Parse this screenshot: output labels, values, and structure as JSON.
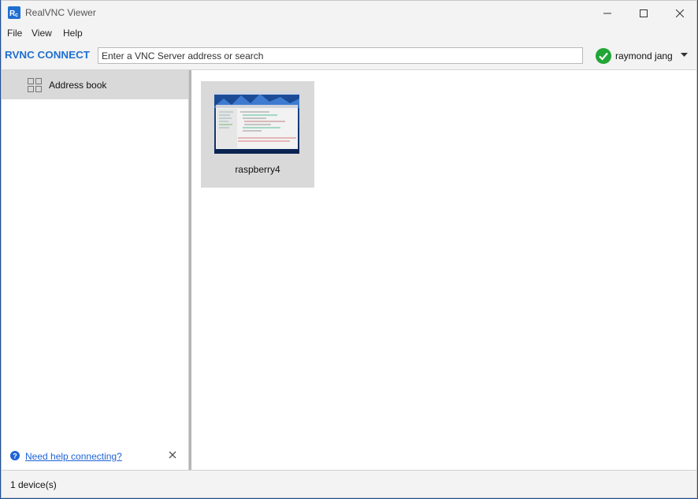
{
  "window": {
    "title": "RealVNC Viewer"
  },
  "menu": {
    "file": "File",
    "view": "View",
    "help": "Help"
  },
  "toolbar": {
    "brand": "RVNC CONNECT",
    "search_placeholder": "Enter a VNC Server address or search",
    "user_name": "raymond jang"
  },
  "sidebar": {
    "items": [
      {
        "label": "Address book",
        "icon": "grid-icon",
        "selected": true
      }
    ],
    "help_link": "Need help connecting?"
  },
  "devices": [
    {
      "name": "raspberry4"
    }
  ],
  "status": {
    "text": "1 device(s)"
  },
  "colors": {
    "accent": "#1e63d6",
    "brand": "#1f6fd1",
    "signed_in": "#21a635",
    "selection": "#d9d9d9"
  }
}
